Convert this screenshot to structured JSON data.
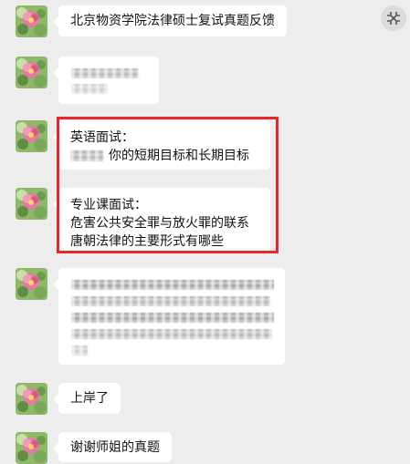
{
  "messages": [
    {
      "type": "text",
      "lines": [
        "北京物资学院法律硕士复试真题反馈"
      ]
    },
    {
      "type": "blurred"
    },
    {
      "type": "text",
      "lines": [
        "英语面试：",
        "你的短期目标和长期目标"
      ]
    },
    {
      "type": "text",
      "lines": [
        "专业课面试：",
        "危害公共安全罪与放火罪的联系",
        "唐朝法律的主要形式有哪些"
      ]
    },
    {
      "type": "blurred"
    },
    {
      "type": "text",
      "lines": [
        "上岸了"
      ]
    },
    {
      "type": "text",
      "lines": [
        "谢谢师姐的真题"
      ]
    }
  ],
  "icons": {
    "avatar": "flower-avatar-icon",
    "corner": "exit-fullscreen-icon"
  },
  "colors": {
    "background": "#ededed",
    "bubble": "#ffffff",
    "highlight": "#e8262c"
  }
}
